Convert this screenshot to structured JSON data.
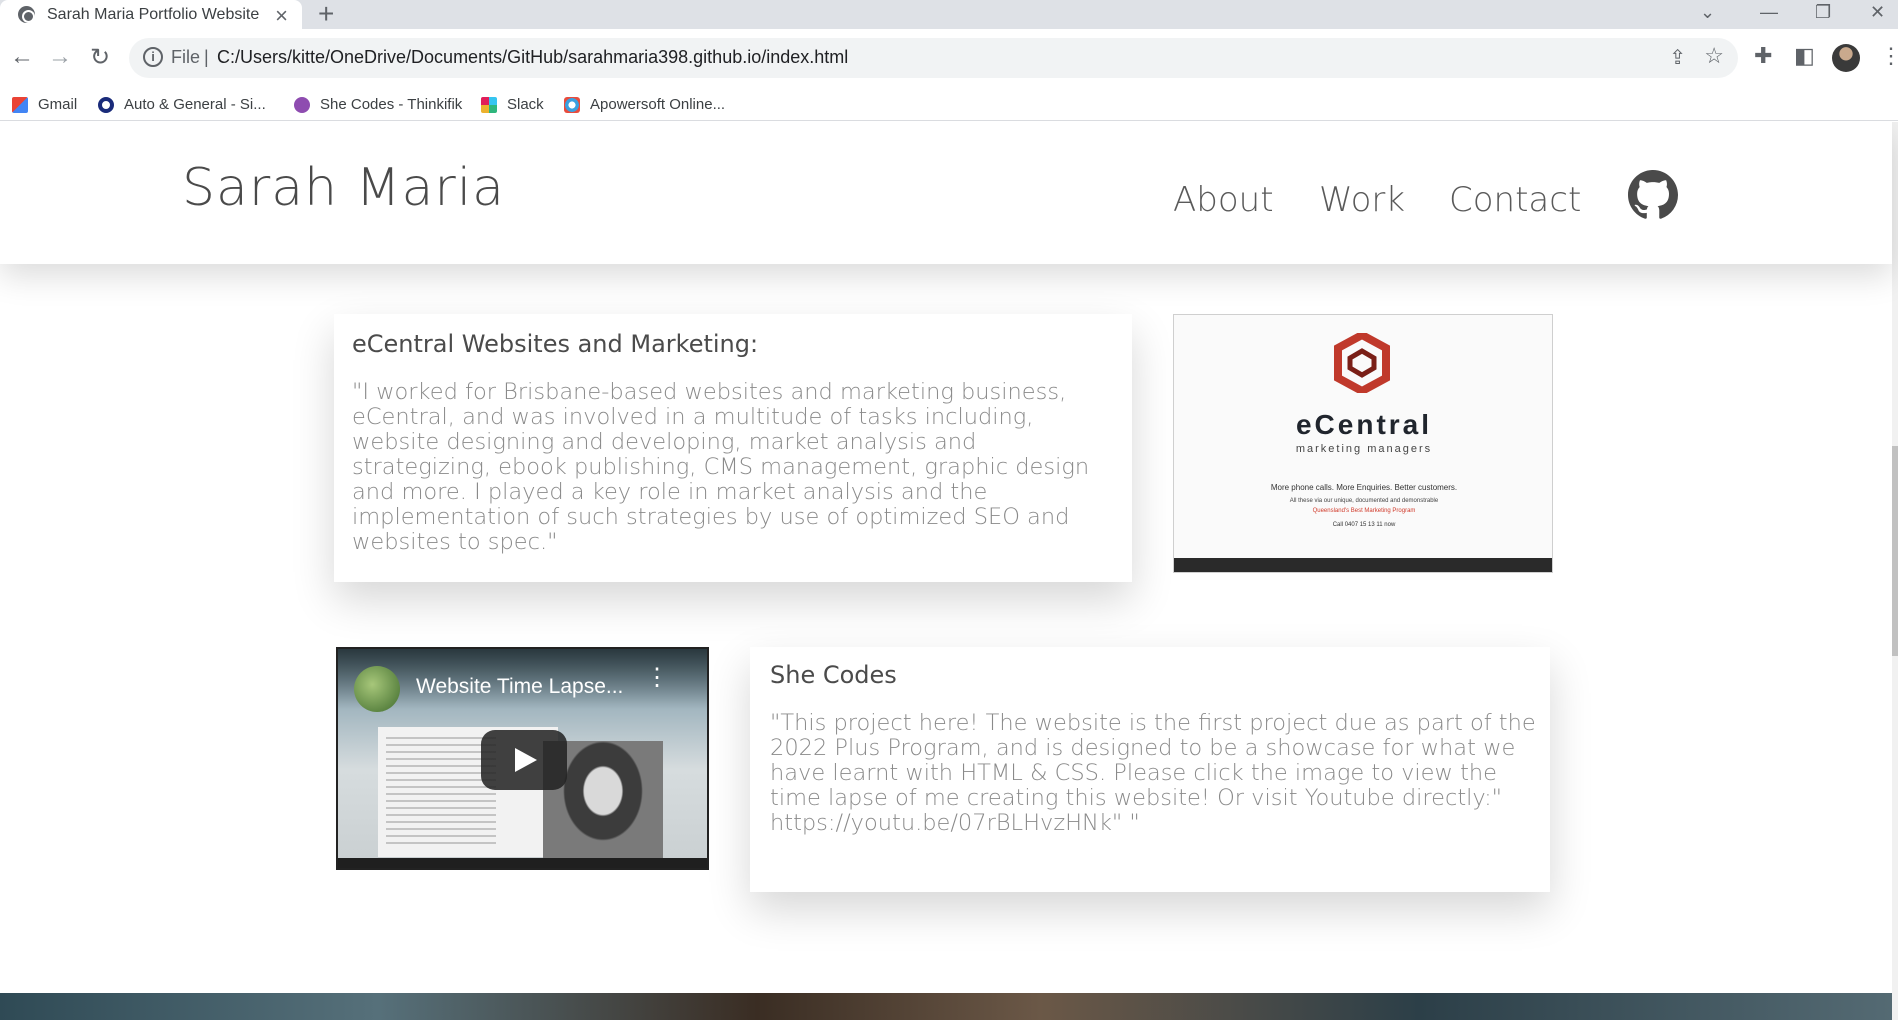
{
  "browser": {
    "tab_title": "Sarah Maria Portfolio Website",
    "address_prefix": "File",
    "url": "C:/Users/kitte/OneDrive/Documents/GitHub/sarahmaria398.github.io/index.html",
    "bookmarks": [
      {
        "label": "Gmail",
        "icon": "gmail-icon"
      },
      {
        "label": "Auto & General - Si...",
        "icon": "auto-general-icon"
      },
      {
        "label": "She Codes - Thinkifik",
        "icon": "she-codes-icon"
      },
      {
        "label": "Slack",
        "icon": "slack-icon"
      },
      {
        "label": "Apowersoft Online...",
        "icon": "apowersoft-icon"
      }
    ]
  },
  "site": {
    "brand": "Sarah Maria",
    "nav": [
      "About",
      "Work",
      "Contact"
    ],
    "github_icon": "github-icon"
  },
  "projects": [
    {
      "title": "eCentral Websites and Marketing:",
      "description": "\"I worked for Brisbane-based websites and marketing business, eCentral, and was involved in a multitude of tasks including, website designing and developing, market analysis and strategizing, ebook publishing, CMS management, graphic design and more. I played a key role in market analysis and the implementation of such strategies by use of optimized SEO and websites to spec.\"",
      "image": {
        "name": "eCentral",
        "subtitle": "marketing managers",
        "tagline": "More phone calls. More Enquiries. Better customers.",
        "line2": "All these via our unique, documented and demonstrable",
        "line3": "Queensland's Best Marketing Program",
        "line4": "Call 0407 15 13 11 now"
      }
    },
    {
      "title": "She Codes",
      "description": "\"This project here! The website is the first project due as part of the 2022 Plus Program, and is designed to be a showcase for what we have learnt with HTML & CSS. Please click the image to view the time lapse of me creating this website! Or visit Youtube directly:\" https://youtu.be/07rBLHvzHNk\" \"",
      "video_title": "Website Time Lapse..."
    }
  ],
  "colors": {
    "ecentral_red": "#c0392b",
    "chrome_bg": "#dee1e6"
  }
}
